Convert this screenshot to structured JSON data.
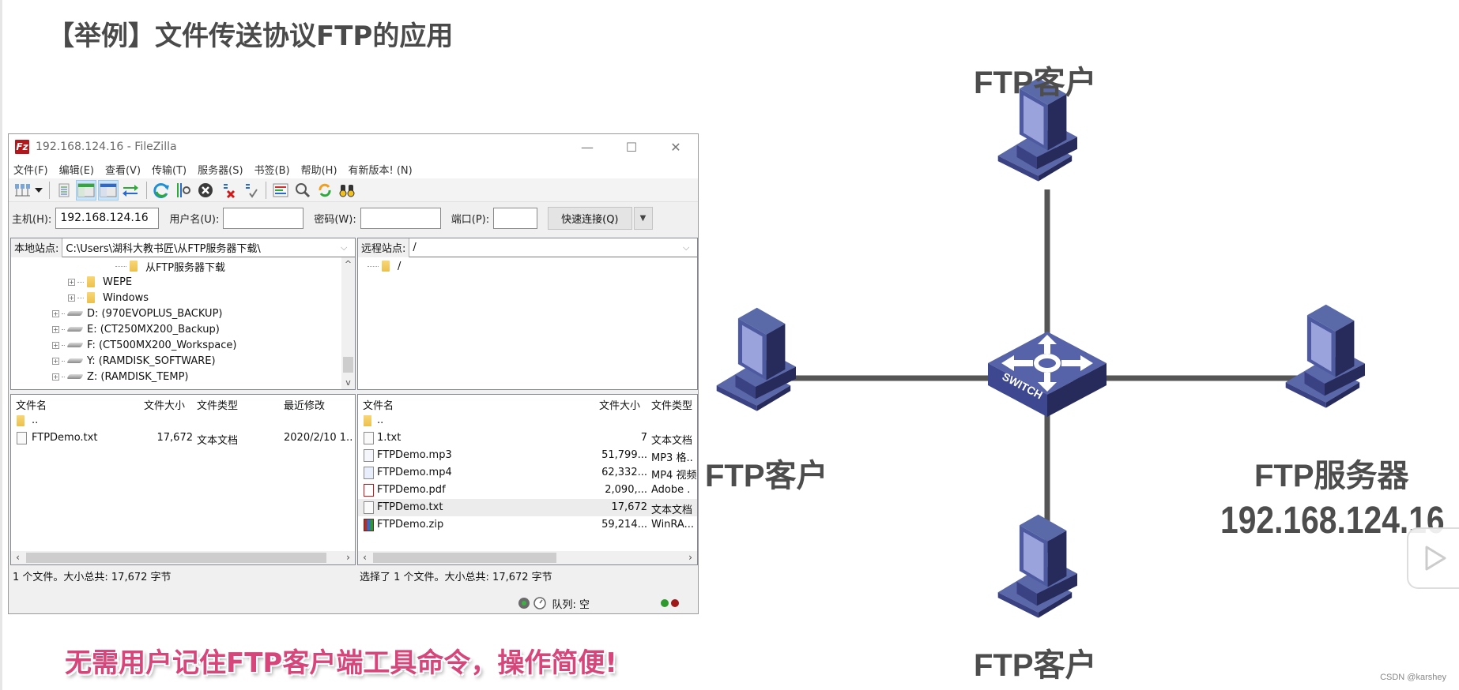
{
  "slide": {
    "title": "【举例】文件传送协议FTP的应用",
    "slogan": "无需用户记住FTP客户端工具命令，操作简便!",
    "watermark": "CSDN @karshey"
  },
  "filezilla": {
    "window_title": "192.168.124.16 - FileZilla",
    "logo_text": "Fz",
    "window_controls": {
      "minimize": "—",
      "maximize": "☐",
      "close": "✕"
    },
    "menu": [
      "文件(F)",
      "编辑(E)",
      "查看(V)",
      "传输(T)",
      "服务器(S)",
      "书签(B)",
      "帮助(H)",
      "有新版本! (N)"
    ],
    "toolbar_icons": [
      "site-manager",
      "dropdown",
      "message-log",
      "local-tree",
      "remote-tree",
      "transfer-queue",
      "refresh",
      "filter-settings",
      "cancel",
      "disconnect",
      "reconnect",
      "directory-comparison",
      "search",
      "sync-browsing",
      "find-files"
    ],
    "quickconnect": {
      "host_label": "主机(H):",
      "host_value": "192.168.124.16",
      "user_label": "用户名(U):",
      "user_value": "",
      "password_label": "密码(W):",
      "password_value": "",
      "port_label": "端口(P):",
      "port_value": "",
      "connect_button": "快速连接(Q)",
      "dropdown_arrow": "▼"
    },
    "local": {
      "site_label": "本地站点:",
      "site_path": "C:\\Users\\湖科大教书匠\\从FTP服务器下载\\",
      "tree": [
        {
          "name": "从FTP服务器下载",
          "type": "folder",
          "expander": ""
        },
        {
          "name": "WEPE",
          "type": "folder",
          "expander": "+"
        },
        {
          "name": "Windows",
          "type": "folder",
          "expander": "+"
        },
        {
          "name": "D: (970EVOPLUS_BACKUP)",
          "type": "drive",
          "expander": "+"
        },
        {
          "name": "E: (CT250MX200_Backup)",
          "type": "drive",
          "expander": "+"
        },
        {
          "name": "F: (CT500MX200_Workspace)",
          "type": "drive",
          "expander": "+"
        },
        {
          "name": "Y: (RAMDISK_SOFTWARE)",
          "type": "drive",
          "expander": "+"
        },
        {
          "name": "Z: (RAMDISK_TEMP)",
          "type": "drive",
          "expander": "+"
        }
      ],
      "columns": [
        "文件名",
        "文件大小",
        "文件类型",
        "最近修改"
      ],
      "files": [
        {
          "name": "..",
          "size": "",
          "type": "",
          "modified": "",
          "icon": "folder"
        },
        {
          "name": "FTPDemo.txt",
          "size": "17,672",
          "type": "文本文档",
          "modified": "2020/2/10 1..",
          "icon": "txt"
        }
      ],
      "status": "1 个文件。大小总共: 17,672 字节"
    },
    "remote": {
      "site_label": "远程站点:",
      "site_path": "/",
      "tree": [
        {
          "name": "/",
          "type": "folder"
        }
      ],
      "columns": [
        "文件名",
        "文件大小",
        "文件类型"
      ],
      "files": [
        {
          "name": "..",
          "size": "",
          "type": "",
          "icon": "folder"
        },
        {
          "name": "1.txt",
          "size": "7",
          "type": "文本文档",
          "icon": "txt"
        },
        {
          "name": "FTPDemo.mp3",
          "size": "51,799...",
          "type": "MP3 格..",
          "icon": "mp3"
        },
        {
          "name": "FTPDemo.mp4",
          "size": "62,332...",
          "type": "MP4 视频",
          "icon": "mp4"
        },
        {
          "name": "FTPDemo.pdf",
          "size": "2,090,...",
          "type": "Adobe .",
          "icon": "pdf"
        },
        {
          "name": "FTPDemo.txt",
          "size": "17,672",
          "type": "文本文档",
          "icon": "txt",
          "selected": true
        },
        {
          "name": "FTPDemo.zip",
          "size": "59,214...",
          "type": "WinRA...",
          "icon": "zip"
        }
      ],
      "status": "选择了 1 个文件。大小总共: 17,672 字节"
    },
    "queue_status": "队列: 空",
    "scroll_arrows": {
      "up": "^",
      "down": "v",
      "left": "‹",
      "right": "›"
    },
    "colors": {
      "led_green": "#2e9a2e",
      "led_red": "#a01818",
      "logo_red": "#b3161b"
    }
  },
  "diagram": {
    "switch_label": "SWITCH",
    "nodes": {
      "top_client": "FTP客户",
      "left_client": "FTP客户",
      "bottom_client": "FTP客户",
      "server": "FTP服务器",
      "server_ip": "192.168.124.16"
    },
    "colors": {
      "device_light": "#5a67a8",
      "device_dark": "#262b5c",
      "screen": "#9aa3dc",
      "link": "#555555",
      "label": "#4d4d4d"
    }
  }
}
